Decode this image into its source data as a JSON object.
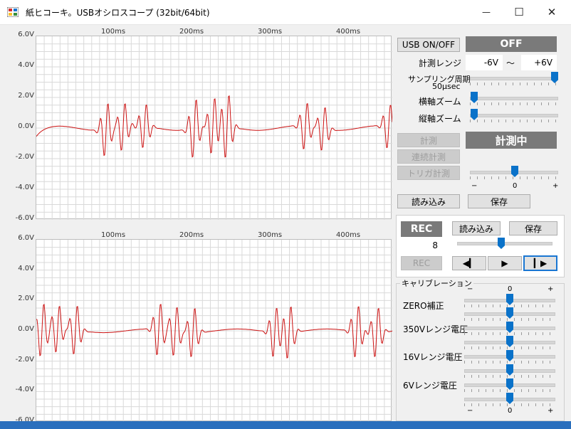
{
  "window": {
    "title": "紙ヒコーキ。USBオシロスコープ (32bit/64bit)",
    "minimize_glyph": "—",
    "maximize_glyph": "☐",
    "close_glyph": "✕"
  },
  "plot_upper": {
    "y_ticks": [
      "6.0V",
      "4.0V",
      "2.0V",
      "0.0V",
      "-2.0V",
      "-4.0V",
      "-6.0V"
    ],
    "x_ticks": [
      "100ms",
      "200ms",
      "300ms",
      "400ms"
    ]
  },
  "plot_lower": {
    "y_ticks": [
      "6.0V",
      "4.0V",
      "2.0V",
      "0.0V",
      "-2.0V",
      "-4.0V",
      "-6.0V"
    ],
    "x_ticks": [
      "100ms",
      "200ms",
      "300ms",
      "400ms"
    ]
  },
  "controls": {
    "usb_button": "USB ON/OFF",
    "usb_status": "OFF",
    "range_label": "計測レンジ",
    "range_min": "-6V",
    "range_sep": "～",
    "range_max": "+6V",
    "sampling_label": "サンプリング周期",
    "sampling_value": "50μsec",
    "h_zoom_label": "横軸ズーム",
    "v_zoom_label": "縦軸ズーム",
    "measure_button": "計測",
    "measure_status": "計測中",
    "continuous_button": "連続計測",
    "trigger_button": "トリガ計測",
    "trigger_min": "−",
    "trigger_zero": "0",
    "trigger_max": "+",
    "load_button": "読み込み",
    "save_button": "保存"
  },
  "recorder": {
    "rec_status": "REC",
    "load_button": "読み込み",
    "save_button": "保存",
    "count_value": "8",
    "rec_button": "REC",
    "rewind_glyph": "◀▎",
    "play_glyph": "▶",
    "step_glyph": "▎▶"
  },
  "calibration": {
    "title": "キャリブレーション",
    "min_mark": "−",
    "zero_mark": "0",
    "max_mark": "+",
    "zero_label": "ZERO補正",
    "v350_label": "350Vレンジ電圧",
    "v16_label": "16Vレンジ電圧",
    "v6_label": "6Vレンジ電圧"
  },
  "colors": {
    "trace": "#cc1111",
    "grid": "#d9d9d9",
    "status_bg": "#7a7a7a",
    "slider_thumb": "#0a72c9"
  }
}
